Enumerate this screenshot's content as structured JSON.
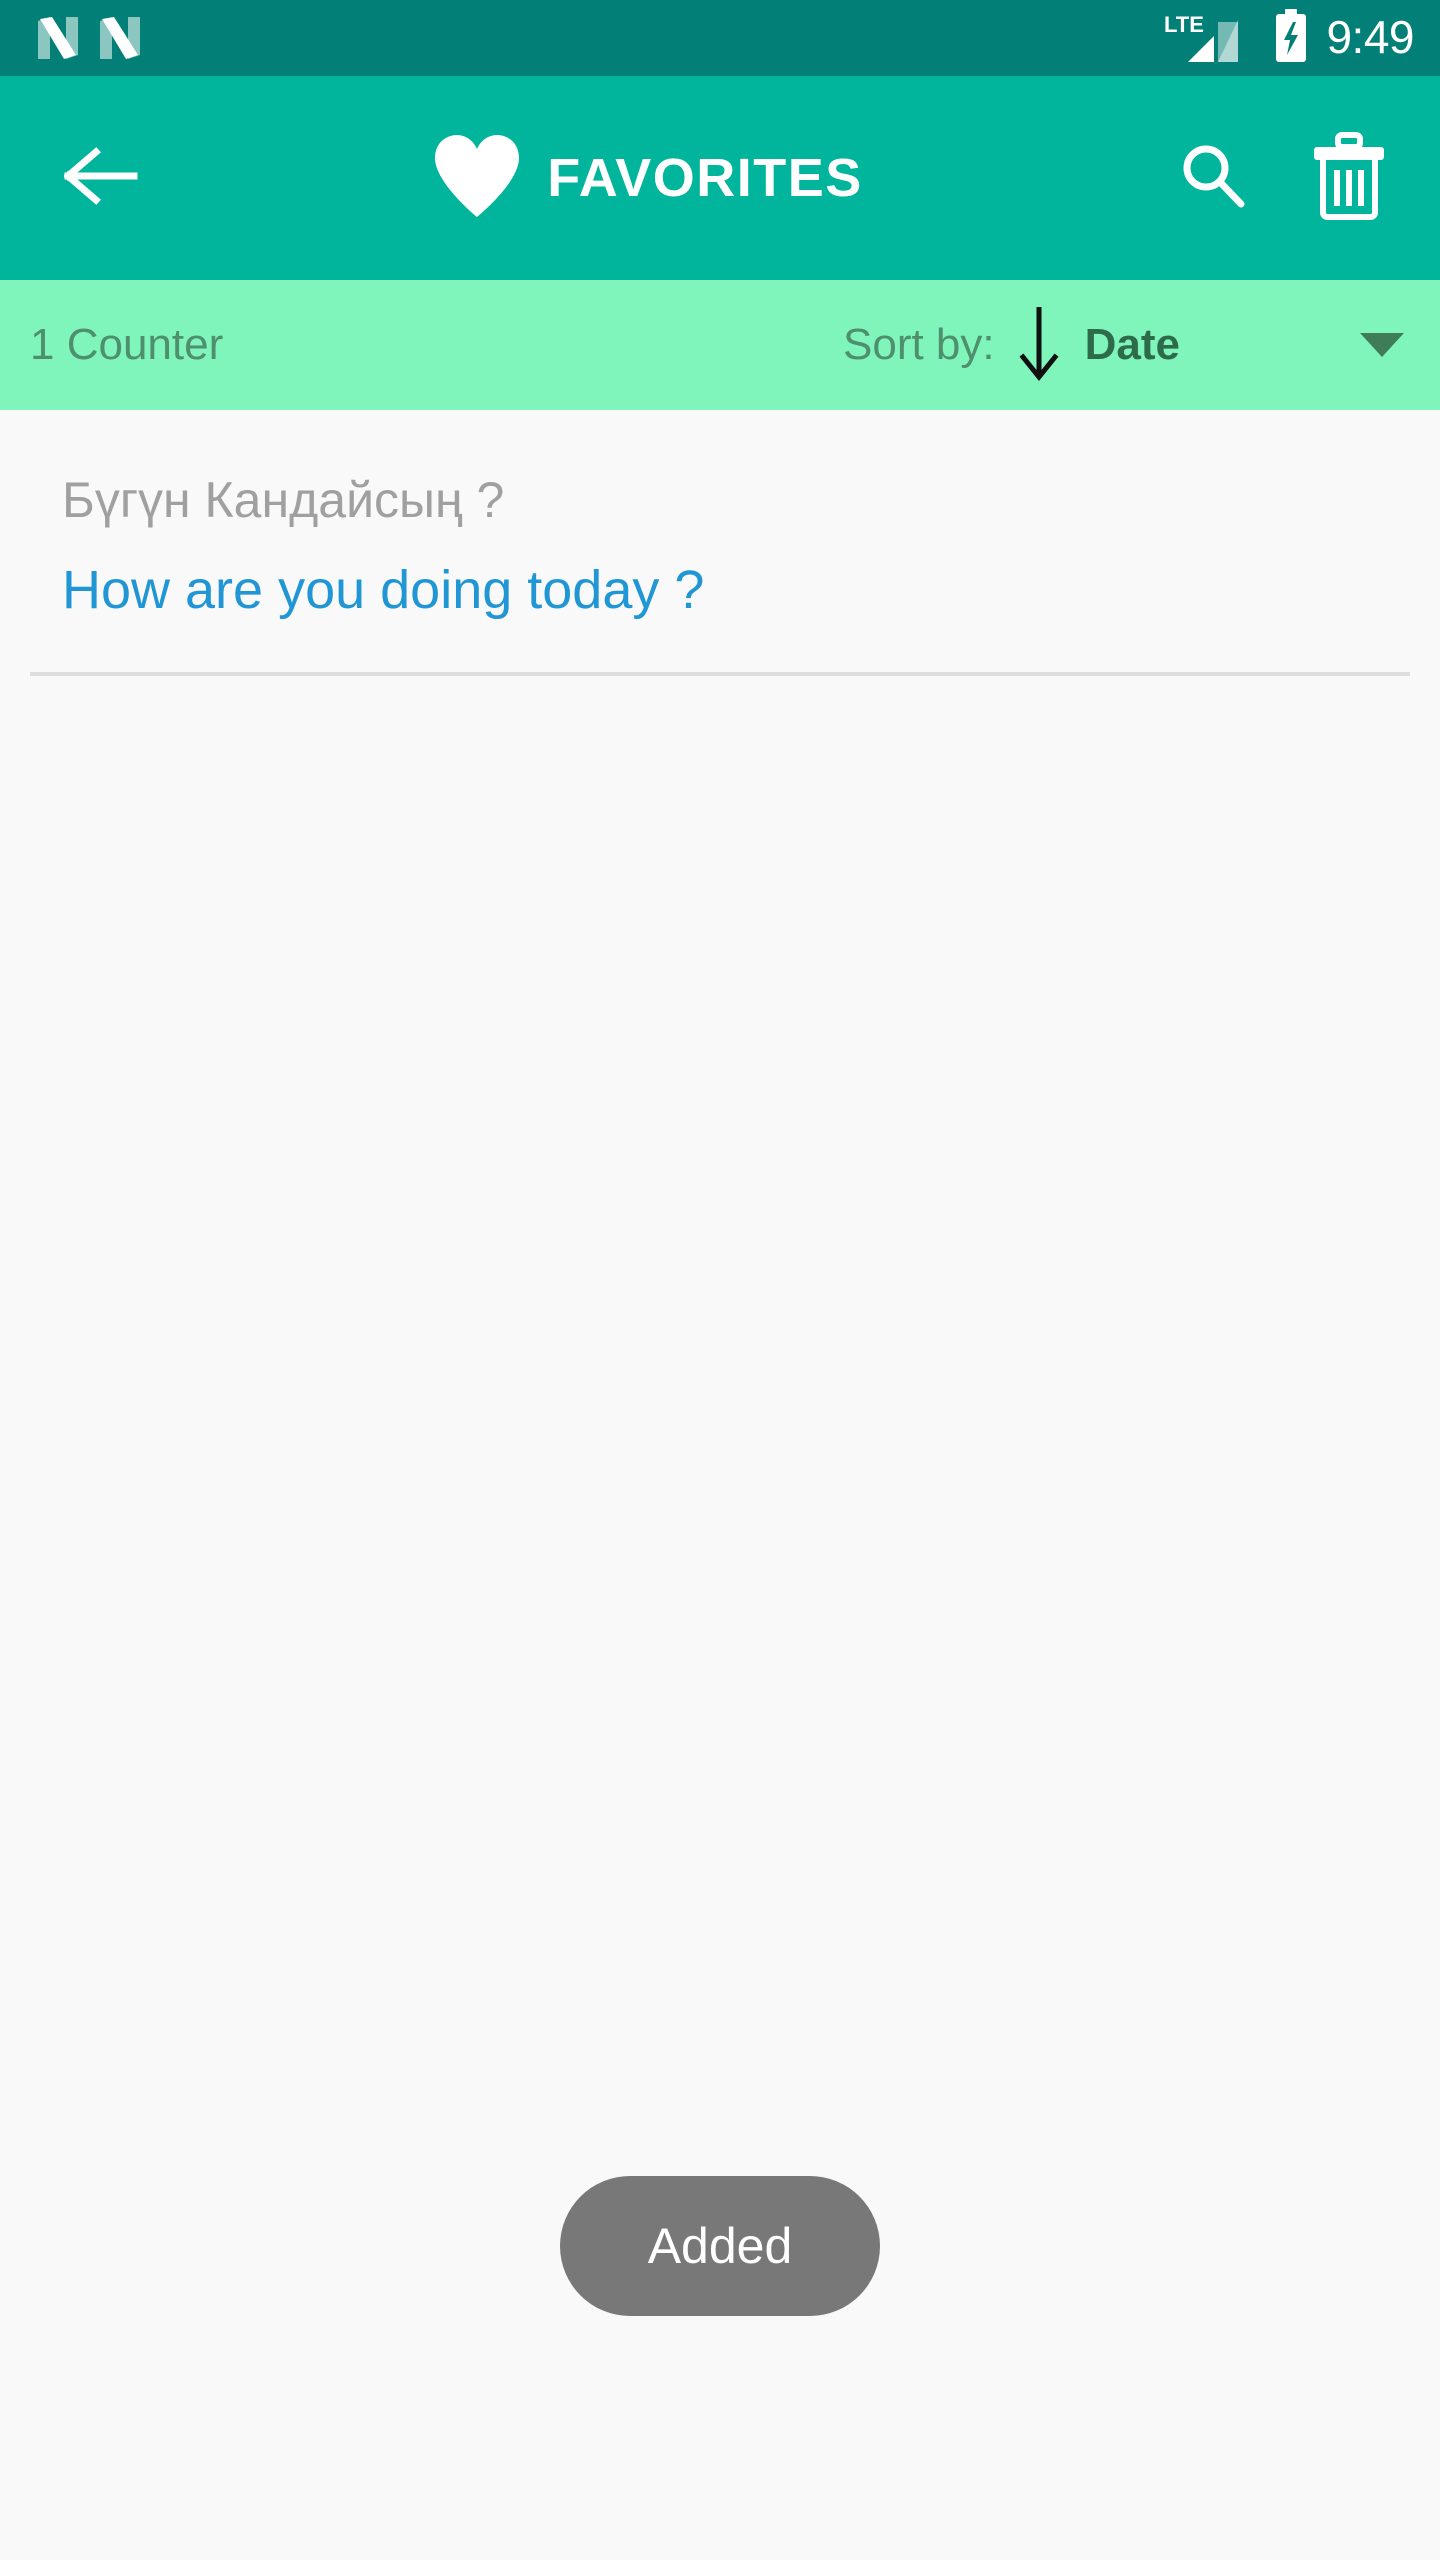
{
  "status_bar": {
    "notifications": [
      {
        "icon": "android-nougat-icon"
      },
      {
        "icon": "android-nougat-icon"
      }
    ],
    "network_type": "LTE",
    "signal_icon": "signal-bars-icon",
    "battery_icon": "battery-charging-icon",
    "time": "9:49",
    "background_color": "#028077"
  },
  "app_bar": {
    "back_icon": "arrow-left-icon",
    "title_icon": "heart-icon",
    "title": "FAVORITES",
    "search_icon": "search-icon",
    "delete_icon": "trash-icon",
    "background_color": "#00b59b",
    "foreground_color": "#ffffff"
  },
  "sort_bar": {
    "counter": "1 Counter",
    "sort_by_label": "Sort by:",
    "sort_direction_icon": "arrow-down-icon",
    "sort_value": "Date",
    "dropdown_icon": "caret-down-icon",
    "background_color": "#7ff5bc",
    "text_color": "#4e8f6e",
    "value_color": "#2e6b4a"
  },
  "list": {
    "items": [
      {
        "source_text": "Бүгүн Кандайсың ?",
        "translated_text": "How are you doing today ?"
      }
    ],
    "source_color": "#a0a0a0",
    "translation_color": "#2196d4",
    "background_color": "#f9f9f9"
  },
  "toast": {
    "message": "Added",
    "background_color": "#787878",
    "text_color": "#ffffff"
  }
}
